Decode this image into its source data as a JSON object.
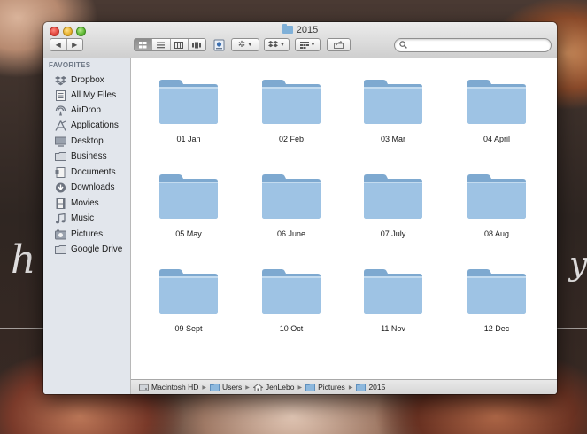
{
  "window": {
    "title": "2015"
  },
  "toolbar": {
    "back_label": "◀",
    "forward_label": "▶",
    "search_placeholder": "",
    "view_modes": [
      "icon-view",
      "list-view",
      "column-view",
      "coverflow-view"
    ],
    "active_view": "icon-view"
  },
  "sidebar": {
    "heading": "FAVORITES",
    "items": [
      {
        "label": "Dropbox",
        "icon": "dropbox-icon"
      },
      {
        "label": "All My Files",
        "icon": "all-my-files-icon"
      },
      {
        "label": "AirDrop",
        "icon": "airdrop-icon"
      },
      {
        "label": "Applications",
        "icon": "applications-icon"
      },
      {
        "label": "Desktop",
        "icon": "desktop-icon"
      },
      {
        "label": "Business",
        "icon": "folder-icon"
      },
      {
        "label": "Documents",
        "icon": "documents-icon"
      },
      {
        "label": "Downloads",
        "icon": "downloads-icon"
      },
      {
        "label": "Movies",
        "icon": "movies-icon"
      },
      {
        "label": "Music",
        "icon": "music-icon"
      },
      {
        "label": "Pictures",
        "icon": "pictures-icon"
      },
      {
        "label": "Google Drive",
        "icon": "folder-icon"
      }
    ]
  },
  "content": {
    "folders": [
      {
        "label": "01 Jan"
      },
      {
        "label": "02 Feb"
      },
      {
        "label": "03 Mar"
      },
      {
        "label": "04 April"
      },
      {
        "label": "05 May"
      },
      {
        "label": "06 June"
      },
      {
        "label": "07 July"
      },
      {
        "label": "08 Aug"
      },
      {
        "label": "09 Sept"
      },
      {
        "label": "10 Oct"
      },
      {
        "label": "11 Nov"
      },
      {
        "label": "12 Dec"
      }
    ]
  },
  "pathbar": {
    "crumbs": [
      {
        "label": "Macintosh HD",
        "icon": "hard-drive-icon"
      },
      {
        "label": "Users",
        "icon": "folder-icon"
      },
      {
        "label": "JenLebo",
        "icon": "home-icon"
      },
      {
        "label": "Pictures",
        "icon": "folder-icon"
      },
      {
        "label": "2015",
        "icon": "folder-icon"
      }
    ]
  },
  "colors": {
    "folder_fill": "#9ec3e4",
    "sidebar_bg": "#e2e6ec",
    "accent": "#7fb0d8"
  }
}
